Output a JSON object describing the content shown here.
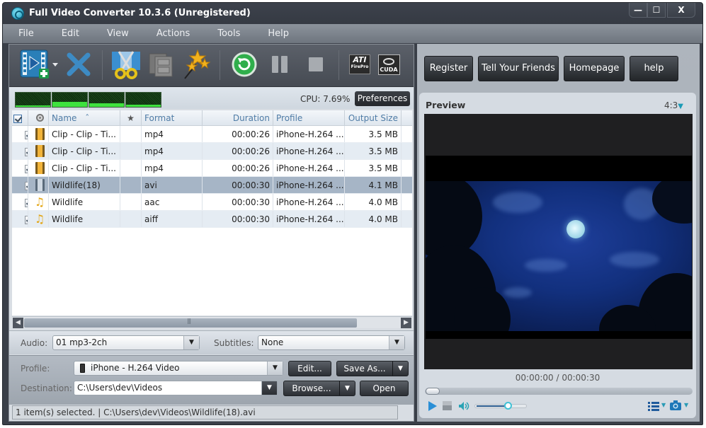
{
  "window": {
    "title": "Full Video Converter 10.3.6 (Unregistered)",
    "controls": {
      "minimize": "—",
      "maximize": "☐",
      "close": "X"
    }
  },
  "menu": [
    "File",
    "Edit",
    "View",
    "Actions",
    "Tools",
    "Help"
  ],
  "toolbar": {
    "buttons": [
      {
        "name": "add-video",
        "icon": "film-add-icon"
      },
      {
        "name": "remove",
        "icon": "x-icon"
      },
      {
        "name": "trim",
        "icon": "scissors-icon"
      },
      {
        "name": "merge",
        "icon": "film-stack-icon"
      },
      {
        "name": "effects",
        "icon": "magic-wand-icon"
      },
      {
        "name": "convert",
        "icon": "convert-icon"
      },
      {
        "name": "pause",
        "icon": "pause-icon"
      },
      {
        "name": "stop",
        "icon": "stop-icon"
      },
      {
        "name": "ati",
        "label": "ATI",
        "sublabel": "FirePro"
      },
      {
        "name": "cuda",
        "label": "CUDA"
      }
    ]
  },
  "monitor": {
    "cpu": "CPU: 7.69%",
    "preferences_label": "Preferences"
  },
  "file_list": {
    "columns": [
      "",
      "",
      "Name",
      "★",
      "Format",
      "Duration",
      "Profile",
      "Output Size"
    ],
    "sort_indicator": "ˆ",
    "rows": [
      {
        "checked": true,
        "type": "video",
        "name": "Clip - Clip - Ti...",
        "format": "mp4",
        "duration": "00:00:26",
        "profile": "iPhone-H.264 ...",
        "size": "3.5 MB",
        "selected": false
      },
      {
        "checked": true,
        "type": "video",
        "name": "Clip - Clip - Ti...",
        "format": "mp4",
        "duration": "00:00:26",
        "profile": "iPhone-H.264 ...",
        "size": "3.5 MB",
        "selected": false
      },
      {
        "checked": true,
        "type": "video",
        "name": "Clip - Clip - Ti...",
        "format": "mp4",
        "duration": "00:00:26",
        "profile": "iPhone-H.264 ...",
        "size": "3.5 MB",
        "selected": false
      },
      {
        "checked": true,
        "type": "video",
        "name": "Wildlife(18)",
        "format": "avi",
        "duration": "00:00:30",
        "profile": "iPhone-H.264 ...",
        "size": "4.1 MB",
        "selected": true
      },
      {
        "checked": true,
        "type": "audio",
        "name": "Wildlife",
        "format": "aac",
        "duration": "00:00:30",
        "profile": "iPhone-H.264 ...",
        "size": "4.0 MB",
        "selected": false
      },
      {
        "checked": true,
        "type": "audio",
        "name": "Wildlife",
        "format": "aiff",
        "duration": "00:00:30",
        "profile": "iPhone-H.264 ...",
        "size": "4.0 MB",
        "selected": false
      }
    ]
  },
  "options": {
    "audio_label": "Audio:",
    "audio_value": "01 mp3-2ch",
    "subtitles_label": "Subtitles:",
    "subtitles_value": "None"
  },
  "output": {
    "profile_label": "Profile:",
    "profile_value": "iPhone - H.264 Video",
    "edit_label": "Edit...",
    "save_as_label": "Save As...",
    "destination_label": "Destination:",
    "destination_value": "C:\\Users\\dev\\Videos",
    "browse_label": "Browse...",
    "open_label": "Open"
  },
  "status": "1 item(s) selected. | C:\\Users\\dev\\Videos\\Wildlife(18).avi",
  "right_buttons": [
    "Register",
    "Tell Your Friends",
    "Homepage",
    "help"
  ],
  "preview": {
    "title": "Preview",
    "aspect": "4:3",
    "time": "00:00:00 / 00:00:30",
    "seek_fraction": 0.0,
    "volume_fraction": 0.68
  },
  "colors": {
    "accent": "#1a9bb6",
    "selected_row": "#a6b5c6",
    "header_text": "#4f7ca6"
  }
}
